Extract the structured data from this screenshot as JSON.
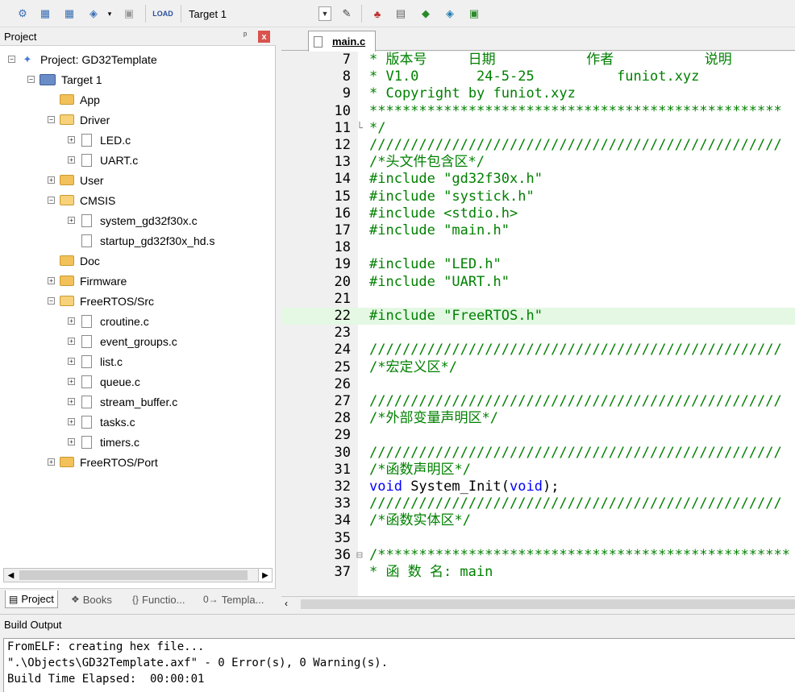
{
  "toolbar": {
    "target_name": "Target 1"
  },
  "project_panel": {
    "title": "Project",
    "pin_glyph": "ᵖ",
    "close_glyph": "x",
    "tree": [
      {
        "label": "Project: GD32Template",
        "kind": "project",
        "toggle": "−"
      },
      {
        "label": "Target 1",
        "kind": "target",
        "toggle": "−"
      },
      {
        "label": "App",
        "kind": "folder",
        "toggle": ""
      },
      {
        "label": "Driver",
        "kind": "folder-open",
        "toggle": "−"
      },
      {
        "label": "LED.c",
        "kind": "file",
        "toggle": "+"
      },
      {
        "label": "UART.c",
        "kind": "file",
        "toggle": "+"
      },
      {
        "label": "User",
        "kind": "folder",
        "toggle": "+"
      },
      {
        "label": "CMSIS",
        "kind": "folder-open",
        "toggle": "−"
      },
      {
        "label": "system_gd32f30x.c",
        "kind": "file",
        "toggle": "+"
      },
      {
        "label": "startup_gd32f30x_hd.s",
        "kind": "file",
        "toggle": ""
      },
      {
        "label": "Doc",
        "kind": "folder",
        "toggle": ""
      },
      {
        "label": "Firmware",
        "kind": "folder",
        "toggle": "+"
      },
      {
        "label": "FreeRTOS/Src",
        "kind": "folder-open",
        "toggle": "−"
      },
      {
        "label": "croutine.c",
        "kind": "file",
        "toggle": "+"
      },
      {
        "label": "event_groups.c",
        "kind": "file",
        "toggle": "+"
      },
      {
        "label": "list.c",
        "kind": "file",
        "toggle": "+"
      },
      {
        "label": "queue.c",
        "kind": "file",
        "toggle": "+"
      },
      {
        "label": "stream_buffer.c",
        "kind": "file",
        "toggle": "+"
      },
      {
        "label": "tasks.c",
        "kind": "file",
        "toggle": "+"
      },
      {
        "label": "timers.c",
        "kind": "file",
        "toggle": "+"
      },
      {
        "label": "FreeRTOS/Port",
        "kind": "folder",
        "toggle": "+"
      }
    ],
    "tabs": [
      {
        "label": "Project",
        "icon": "▤",
        "active": true
      },
      {
        "label": "Books",
        "icon": "❖",
        "active": false
      },
      {
        "label": "Functio...",
        "icon": "{}",
        "active": false
      },
      {
        "label": "Templa...",
        "icon": "0→",
        "active": false
      }
    ]
  },
  "editor": {
    "tab_label": "main.c",
    "lines": [
      {
        "n": "7",
        "text": "* 版本号     日期           作者           说明",
        "cls": "c-comment"
      },
      {
        "n": "8",
        "text": "* V1.0       24-5-25          funiot.xyz",
        "cls": "c-comment"
      },
      {
        "n": "9",
        "text": "* Copyright by funiot.xyz",
        "cls": "c-comment"
      },
      {
        "n": "10",
        "text": "**************************************************",
        "cls": "c-comment"
      },
      {
        "n": "11",
        "text": "*/",
        "cls": "c-comment",
        "fold": "└"
      },
      {
        "n": "12",
        "text": "//////////////////////////////////////////////////",
        "cls": "c-comment"
      },
      {
        "n": "13",
        "text": "/*头文件包含区*/",
        "cls": "c-comment"
      },
      {
        "n": "14",
        "text": "#include \"gd32f30x.h\"",
        "cls": "c-pre"
      },
      {
        "n": "15",
        "text": "#include \"systick.h\"",
        "cls": "c-pre"
      },
      {
        "n": "16",
        "text": "#include <stdio.h>",
        "cls": "c-pre"
      },
      {
        "n": "17",
        "text": "#include \"main.h\"",
        "cls": "c-pre"
      },
      {
        "n": "18",
        "text": "",
        "cls": "c-plain"
      },
      {
        "n": "19",
        "text": "#include \"LED.h\"",
        "cls": "c-pre"
      },
      {
        "n": "20",
        "text": "#include \"UART.h\"",
        "cls": "c-pre"
      },
      {
        "n": "21",
        "text": "",
        "cls": "c-plain"
      },
      {
        "n": "22",
        "text": "#include \"FreeRTOS.h\"",
        "cls": "c-pre",
        "hl": true
      },
      {
        "n": "23",
        "text": "",
        "cls": "c-plain"
      },
      {
        "n": "24",
        "text": "//////////////////////////////////////////////////",
        "cls": "c-comment"
      },
      {
        "n": "25",
        "text": "/*宏定义区*/",
        "cls": "c-comment"
      },
      {
        "n": "26",
        "text": "",
        "cls": "c-plain"
      },
      {
        "n": "27",
        "text": "//////////////////////////////////////////////////",
        "cls": "c-comment"
      },
      {
        "n": "28",
        "text": "/*外部变量声明区*/",
        "cls": "c-comment"
      },
      {
        "n": "29",
        "text": "",
        "cls": "c-plain"
      },
      {
        "n": "30",
        "text": "//////////////////////////////////////////////////",
        "cls": "c-comment"
      },
      {
        "n": "31",
        "text": "/*函数声明区*/",
        "cls": "c-comment"
      },
      {
        "n": "32",
        "text": "void System_Init(void);",
        "cls": "c-mixed"
      },
      {
        "n": "33",
        "text": "//////////////////////////////////////////////////",
        "cls": "c-comment"
      },
      {
        "n": "34",
        "text": "/*函数实体区*/",
        "cls": "c-comment"
      },
      {
        "n": "35",
        "text": "",
        "cls": "c-plain"
      },
      {
        "n": "36",
        "text": "/**************************************************",
        "cls": "c-comment",
        "fold": "⊟"
      },
      {
        "n": "37",
        "text": "* 函 数 名: main",
        "cls": "c-comment"
      }
    ]
  },
  "build_output": {
    "title": "Build Output",
    "lines": [
      "FromELF: creating hex file...",
      "\".\\Objects\\GD32Template.axf\" - 0 Error(s), 0 Warning(s).",
      "Build Time Elapsed:  00:00:01"
    ]
  }
}
